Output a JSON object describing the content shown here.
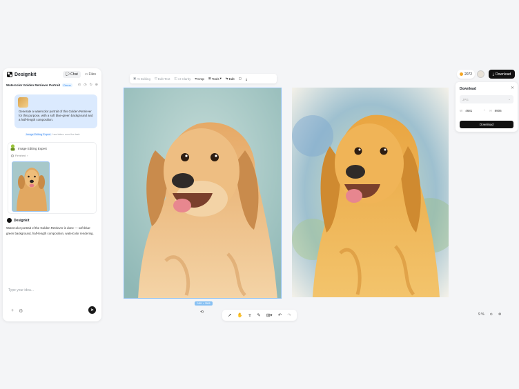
{
  "app": {
    "name": "Designkit"
  },
  "panel": {
    "tabs": [
      {
        "label": "Chat"
      },
      {
        "label": "Files"
      }
    ],
    "conversation_title": "Watercolor Golden Retriever Portrait",
    "badge": "Demo",
    "user_message": "Generate a watercolor portrait of this Golden Retriever for this purpose, with a soft blue-green background and a half-length composition.",
    "chip_label": "Image Editing Expert",
    "chip_note": "has taken over the task",
    "expert_name": "Image Editing Expert",
    "expert_status": "Finished",
    "ai_name": "Designkit",
    "ai_text": "Watercolor portrait of the Golden Retriever is done — soft blue-green background, half-length composition, watercolor rendering.",
    "input_placeholder": "Type your idea..."
  },
  "toolbar": {
    "items": [
      {
        "label": "AI Editing",
        "icon": "ai-edit-icon"
      },
      {
        "label": "Edit Text",
        "icon": "text-icon"
      },
      {
        "label": "AI Clarity",
        "icon": "clarity-icon"
      },
      {
        "label": "Crop",
        "icon": "crop-icon"
      },
      {
        "label": "Tools",
        "icon": "tools-icon"
      },
      {
        "label": "Edit",
        "icon": "edit-icon"
      }
    ]
  },
  "canvas": {
    "size_label": "2481 × 3508"
  },
  "header": {
    "credits": "2072",
    "download_label": "Download"
  },
  "download_panel": {
    "title": "Download",
    "format_placeholder": "JPG",
    "width_key": "W",
    "width": "4681",
    "height_key": "H",
    "height": "8906",
    "button_label": "Download"
  },
  "zoom": {
    "value": "9",
    "unit": "%"
  },
  "colors": {
    "accent": "#3b8cf0",
    "selection": "#8ec0f0",
    "user_bubble": "#dbeafe",
    "button_dark": "#111111"
  }
}
